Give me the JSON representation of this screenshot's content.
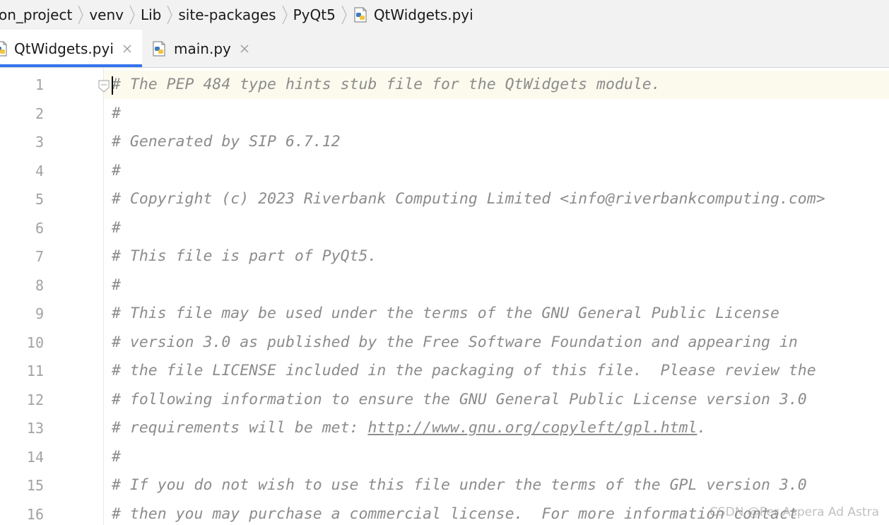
{
  "breadcrumb": {
    "items": [
      "on_project",
      "venv",
      "Lib",
      "site-packages",
      "PyQt5",
      "QtWidgets.pyi"
    ],
    "separator_icon": "chevron-right-icon",
    "file_icon": "python-file-icon"
  },
  "tabs": [
    {
      "label": "QtWidgets.pyi",
      "active": true,
      "icon": "python-file-icon",
      "close_icon": "close-icon"
    },
    {
      "label": "main.py",
      "active": false,
      "icon": "python-file-icon",
      "close_icon": "close-icon"
    }
  ],
  "editor": {
    "line_numbers": [
      "1",
      "2",
      "3",
      "4",
      "5",
      "6",
      "7",
      "8",
      "9",
      "10",
      "11",
      "12",
      "13",
      "14",
      "15",
      "16"
    ],
    "lines": [
      "# The PEP 484 type hints stub file for the QtWidgets module.",
      "#",
      "# Generated by SIP 6.7.12",
      "#",
      "# Copyright (c) 2023 Riverbank Computing Limited <info@riverbankcomputing.com>",
      "#",
      "# This file is part of PyQt5.",
      "#",
      "# This file may be used under the terms of the GNU General Public License",
      "# version 3.0 as published by the Free Software Foundation and appearing in",
      "# the file LICENSE included in the packaging of this file.  Please review the",
      "# following information to ensure the GNU General Public License version 3.0",
      "# requirements will be met: ",
      "#",
      "# If you do not wish to use this file under the terms of the GPL version 3.0",
      "# then you may purchase a commercial license.  For more information contact"
    ],
    "line13_link": "http://www.gnu.org/copyleft/gpl.html",
    "line13_suffix": ".",
    "current_line": "1",
    "comment_color": "#8c8c8c",
    "line_number_color": "#a2a2a2",
    "current_line_bg": "#fcfaed",
    "accent_color": "#3573f0"
  },
  "watermark": "CSDN @Per Aspera Ad Astra"
}
